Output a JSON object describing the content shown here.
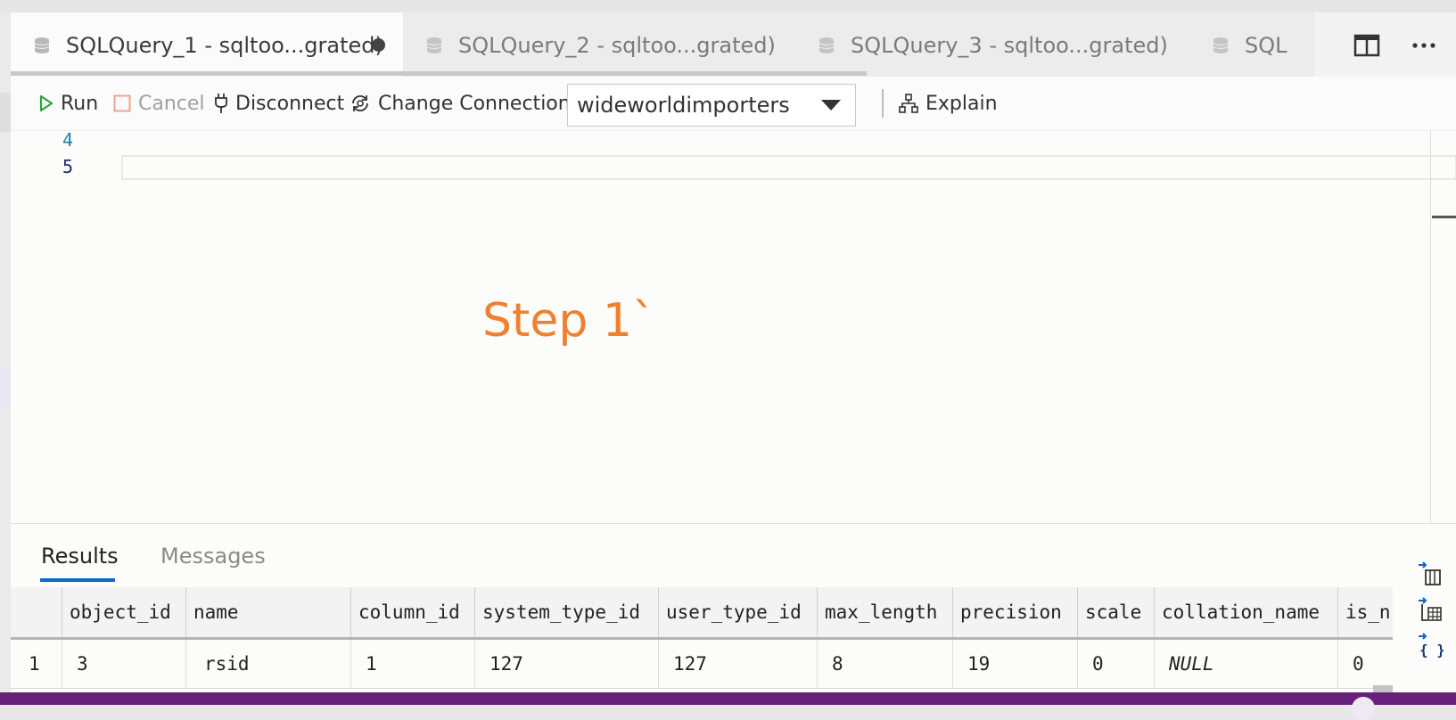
{
  "tabs": [
    {
      "label": "SQLQuery_1 - sqltoo...grated)",
      "active": true,
      "dirty": true
    },
    {
      "label": "SQLQuery_2 - sqltoo...grated)",
      "active": false,
      "dirty": false
    },
    {
      "label": "SQLQuery_3 - sqltoo...grated)",
      "active": false,
      "dirty": false
    },
    {
      "label": "SQL",
      "active": false,
      "dirty": false
    }
  ],
  "toolbar": {
    "run_label": "Run",
    "cancel_label": "Cancel",
    "disconnect_label": "Disconnect",
    "change_connection_label": "Change Connection",
    "database": "wideworldimporters",
    "explain_label": "Explain"
  },
  "editor": {
    "line_numbers": [
      "4",
      "5"
    ],
    "annotation": "Step 1`"
  },
  "results": {
    "tabs": [
      "Results",
      "Messages"
    ],
    "active_tab": "Results",
    "columns": [
      "",
      "object_id",
      "name",
      "column_id",
      "system_type_id",
      "user_type_id",
      "max_length",
      "precision",
      "scale",
      "collation_name",
      "is_n"
    ],
    "rows": [
      [
        "1",
        "3",
        "rsid",
        "1",
        "127",
        "127",
        "8",
        "19",
        "0",
        "NULL",
        "0"
      ]
    ]
  },
  "colors": {
    "status_bar": "#68217a",
    "annotation": "#f08030",
    "accent": "#0e68c4",
    "run_icon": "#2ea043"
  },
  "icons": {
    "tab_icon": "database-icon",
    "side": [
      "export-csv-icon",
      "export-excel-icon",
      "export-json-icon"
    ]
  }
}
